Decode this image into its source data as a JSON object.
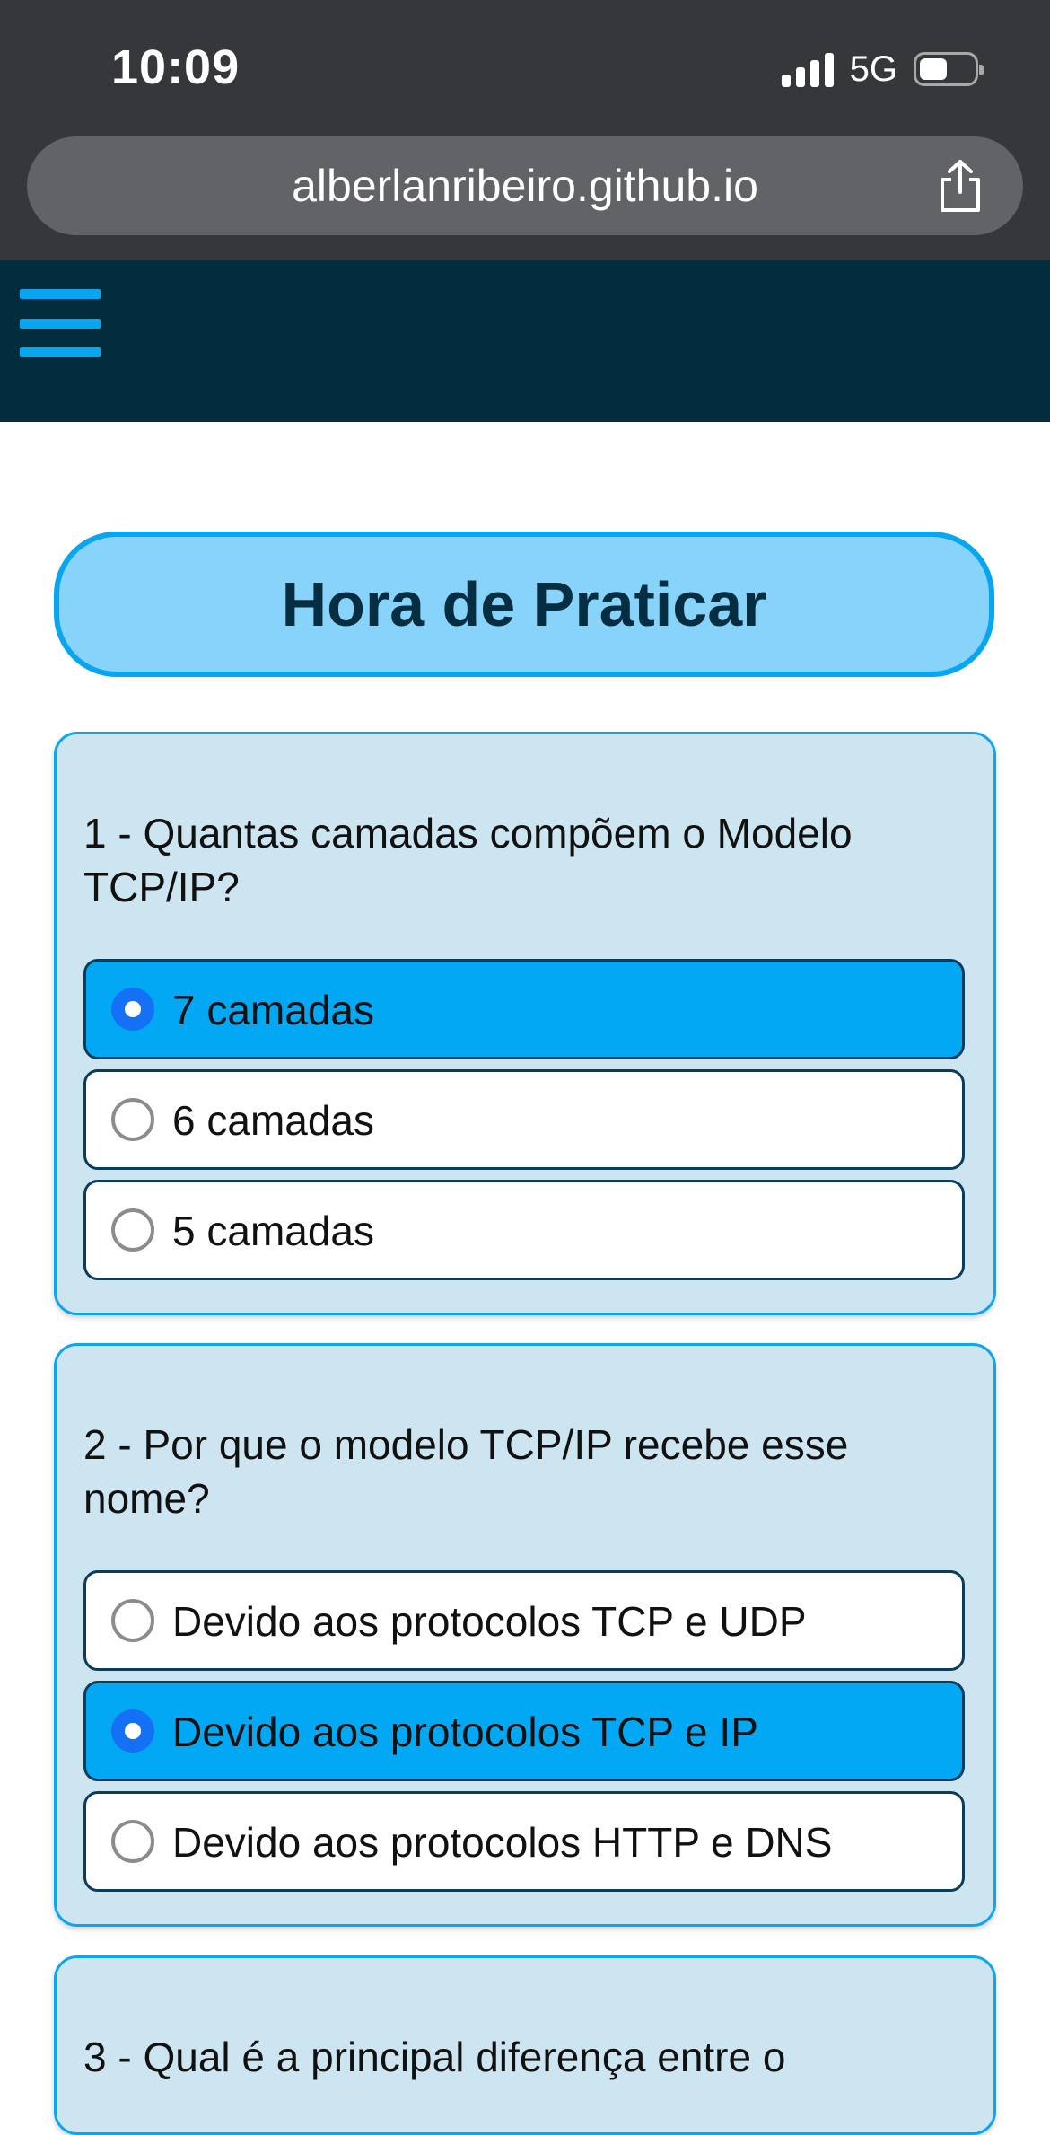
{
  "status_bar": {
    "time": "10:09",
    "network": "5G",
    "signal_icon": "signal-bars-icon",
    "battery_icon": "battery-icon"
  },
  "browser": {
    "url": "alberlanribeiro.github.io",
    "share_icon": "share-icon"
  },
  "header": {
    "menu_icon": "hamburger-menu-icon",
    "background_color": "#032d3f",
    "accent_color": "#07a6ef"
  },
  "page": {
    "title": "Hora de Praticar"
  },
  "questions": [
    {
      "text": "1 - Quantas camadas compõem o Modelo TCP/IP?",
      "options": [
        {
          "label": "7 camadas",
          "selected": true
        },
        {
          "label": "6 camadas",
          "selected": false
        },
        {
          "label": "5 camadas",
          "selected": false
        }
      ]
    },
    {
      "text": "2 - Por que o modelo TCP/IP recebe esse nome?",
      "options": [
        {
          "label": "Devido aos protocolos TCP e UDP",
          "selected": false
        },
        {
          "label": "Devido aos protocolos TCP e IP",
          "selected": true
        },
        {
          "label": "Devido aos protocolos HTTP e DNS",
          "selected": false
        }
      ]
    },
    {
      "text": "3 - Qual é a principal diferença entre o",
      "options": []
    }
  ],
  "colors": {
    "selected_option": "#02a8f4",
    "card_background": "#cde5f1",
    "card_border": "#0ba6ee",
    "title_background": "#87d3fa",
    "radio_checked": "#1470f5"
  }
}
